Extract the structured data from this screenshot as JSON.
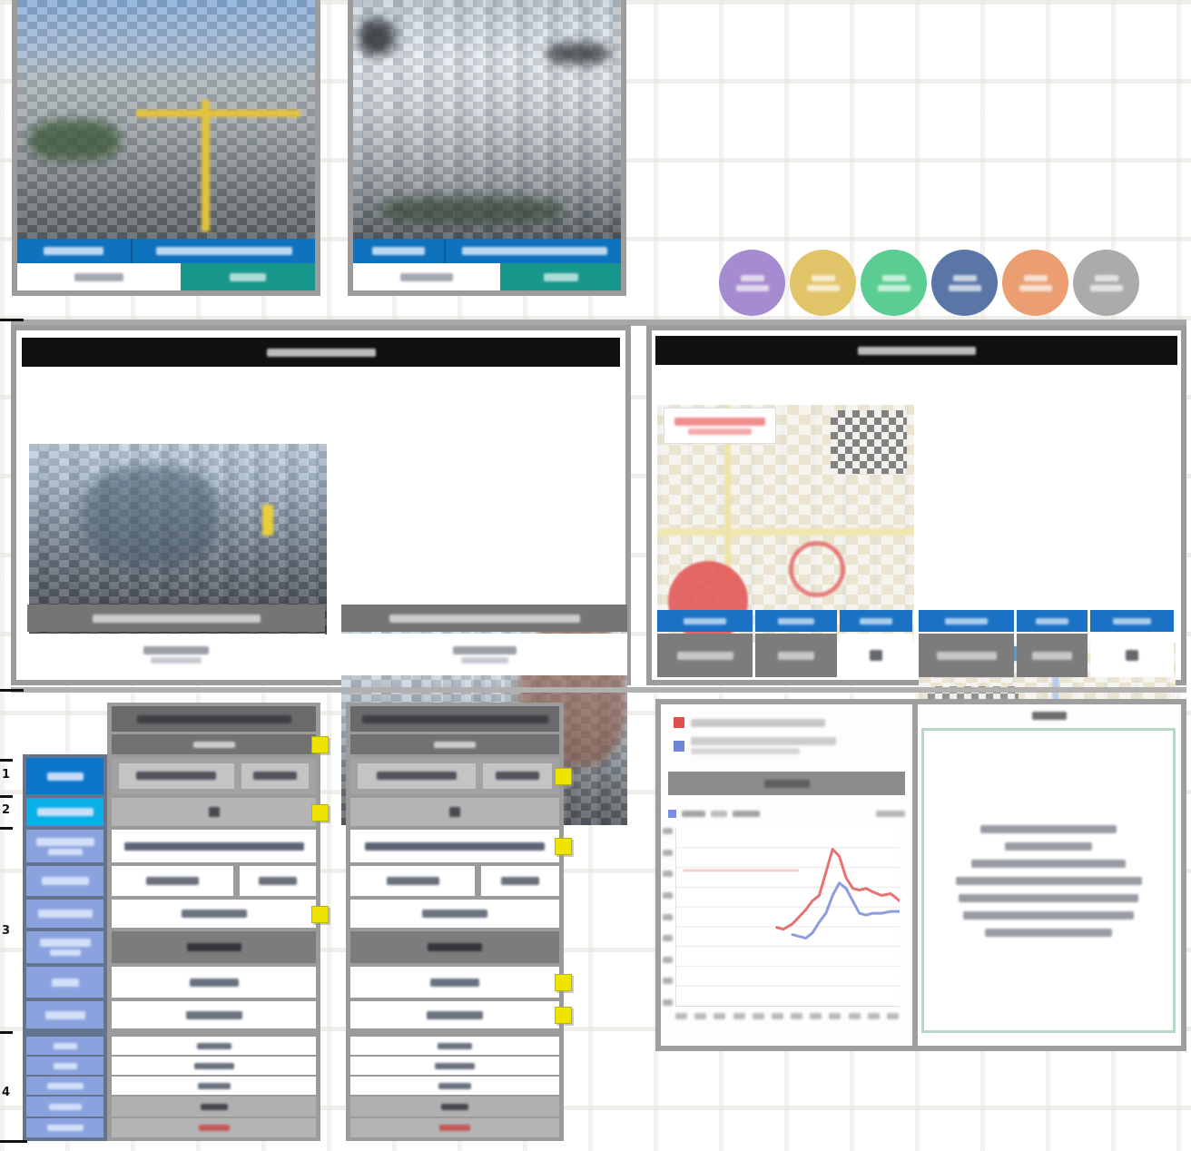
{
  "document": {
    "kind": "spreadsheet real-estate comparison report",
    "language": "Korean",
    "legibility": "nearly all text in the source screenshot is blurred beyond recognition"
  },
  "outline": {
    "numbers": [
      "1",
      "2",
      "3",
      "4"
    ]
  },
  "palette": {
    "frameGray": "#9c9c9c",
    "gapGray": "#9b9b9b",
    "blackBar": "#101010",
    "accentBlue": "#0f72bd",
    "teal": "#17978c",
    "captionGray": "#757575",
    "mapHeaderBlue": "#1b72c4",
    "darkCellGray": "#7c7c7c",
    "titleGray": "#6a6a6a",
    "subGray": "#717171",
    "hdrBlue": "#0a76cc",
    "hdrCyan": "#09b0e8",
    "hdrPeri": "#8aa2de",
    "hdrGap": "#64748f",
    "yellow": "#efe400",
    "greenBorder": "#b9d7c5",
    "redMark": "#e25959",
    "greenMark": "#4cbf72",
    "ringRed": "#e05a5a",
    "ringBlue": "#5b82d6",
    "r1Bg": "#a2a2a2",
    "insetGray": "#c4c4c4",
    "grayRow": "#b4b4b4",
    "chartRed": "#e04f4f",
    "chartBlue": "#6f86d8"
  },
  "top_section": {
    "photo_cards": 2,
    "badges": {
      "count": 6,
      "colors": [
        "#a58bd0",
        "#e2c468",
        "#5bcd92",
        "#5a76a6",
        "#ea9e72",
        "#ababab"
      ]
    }
  },
  "middle_section": {
    "left_block": {
      "header": "black title bar (text illegible)",
      "photos": 2
    },
    "right_block": {
      "header": "black title bar (text illegible)",
      "maps": [
        {
          "label_color": "red",
          "marker": "large red dot bottom-left, red ring center",
          "qr": true
        },
        {
          "label_color": "blue",
          "marker": "large green dot bottom-right, blue ring center",
          "qr": true
        }
      ],
      "map_table_columns": 3
    }
  },
  "bottom_section": {
    "comparison_columns": 2,
    "yellow_note_markers": 7,
    "last_row_text_color": "red"
  },
  "chart_data": {
    "type": "line",
    "title": "",
    "legend": [
      {
        "color": "#e04f4f",
        "label": "(illegible red series)"
      },
      {
        "color": "#6f86d8",
        "label": "(illegible blue series)"
      }
    ],
    "x_axis": {
      "tick_labels": "illegible",
      "approx_ticks": 12
    },
    "y_axis": {
      "tick_labels": "illegible",
      "gridlines": 8,
      "scale": "percent of plot height"
    },
    "reference_line": {
      "color": "#f2bcbc",
      "y": 76,
      "x_start": 3,
      "x_end": 55
    },
    "series": [
      {
        "name": "red",
        "color": "#e04f4f",
        "x": [
          45,
          48,
          52,
          55,
          58,
          61,
          64,
          67,
          70,
          73,
          76,
          79,
          82,
          85,
          88,
          92,
          96,
          100
        ],
        "y": [
          44,
          43,
          46,
          50,
          54,
          59,
          62,
          75,
          88,
          84,
          72,
          66,
          65,
          66,
          64,
          62,
          63,
          59
        ]
      },
      {
        "name": "blue",
        "color": "#6f86d8",
        "x": [
          52,
          55,
          58,
          61,
          64,
          67,
          70,
          73,
          76,
          79,
          82,
          85,
          88,
          92,
          96,
          100
        ],
        "y": [
          40,
          39,
          38,
          41,
          47,
          52,
          62,
          69,
          66,
          59,
          52,
          51,
          52,
          52,
          53,
          53
        ]
      }
    ]
  }
}
